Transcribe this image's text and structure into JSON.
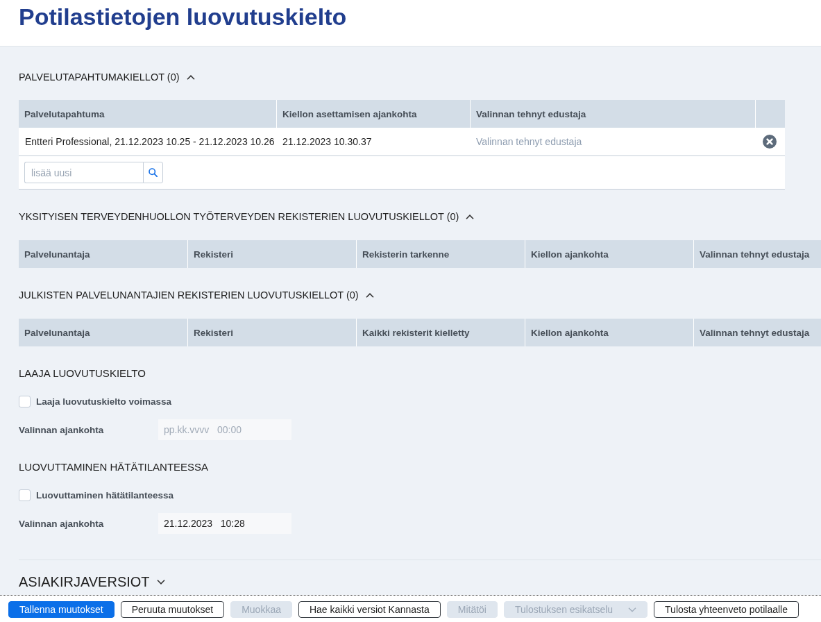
{
  "page": {
    "title": "Potilastietojen luovutuskielto"
  },
  "sections": [
    {
      "kind": "event_table",
      "heading": "PALVELUTAPAHTUMAKIELLOT (0)",
      "expanded": true,
      "columns": [
        "Palvelutapahtuma",
        "Kiellon asettamisen ajankohta",
        "Valinnan tehnyt edustaja"
      ],
      "rows": [
        {
          "cells": [
            "Entteri Professional, 21.12.2023 10.25 - 21.12.2023 10.26",
            "21.12.2023 10.30.37"
          ],
          "representative": {
            "placeholder": "Valinnan tehnyt edustaja"
          }
        }
      ],
      "add_field": {
        "placeholder": "lisää uusi"
      }
    },
    {
      "kind": "register_table",
      "heading": "YKSITYISEN TERVEYDENHUOLLON TYÖTERVEYDEN REKISTERIEN LUOVUTUSKIELLOT (0)",
      "expanded": true,
      "columns": [
        "Palvelunantaja",
        "Rekisteri",
        "Rekisterin tarkenne",
        "Kiellon ajankohta",
        "Valinnan tehnyt edustaja"
      ]
    },
    {
      "kind": "register_table",
      "heading": "JULKISTEN PALVELUNANTAJIEN REKISTERIEN LUOVUTUSKIELLOT (0)",
      "expanded": true,
      "columns": [
        "Palvelunantaja",
        "Rekisteri",
        "Kaikki rekisterit kielletty",
        "Kiellon ajankohta",
        "Valinnan tehnyt edustaja"
      ]
    },
    {
      "kind": "consent",
      "heading": "LAAJA LUOVUTUSKIELTO",
      "checkbox": {
        "label": "Laaja luovutuskielto voimassa",
        "checked": false
      },
      "time_field": {
        "label": "Valinnan ajankohta",
        "placeholder": "pp.kk.vvvv   00:00"
      }
    },
    {
      "kind": "consent",
      "heading": "LUOVUTTAMINEN HÄTÄTILANTEESSA",
      "checkbox": {
        "label": "Luovuttaminen hätätilanteessa",
        "checked": false
      },
      "time_field": {
        "label": "Valinnan ajankohta",
        "value": "21.12.2023   10:28"
      }
    },
    {
      "kind": "collapsible",
      "heading": "ASIAKIRJAVERSIOT",
      "expanded": false
    }
  ],
  "footer": {
    "buttons": [
      {
        "label": "Tallenna muutokset",
        "kind": "primary",
        "disabled": false
      },
      {
        "label": "Peruuta muutokset",
        "kind": "default",
        "disabled": false
      },
      {
        "label": "Muokkaa",
        "kind": "default",
        "disabled": true
      },
      {
        "label": "Hae kaikki versiot Kannasta",
        "kind": "default",
        "disabled": false
      },
      {
        "label": "Mitätöi",
        "kind": "default",
        "disabled": true
      },
      {
        "label": "Tulostuksen esikatselu",
        "kind": "dropdown",
        "disabled": true
      },
      {
        "label": "Tulosta yhteenveto potilaalle",
        "kind": "default",
        "disabled": false
      }
    ]
  }
}
